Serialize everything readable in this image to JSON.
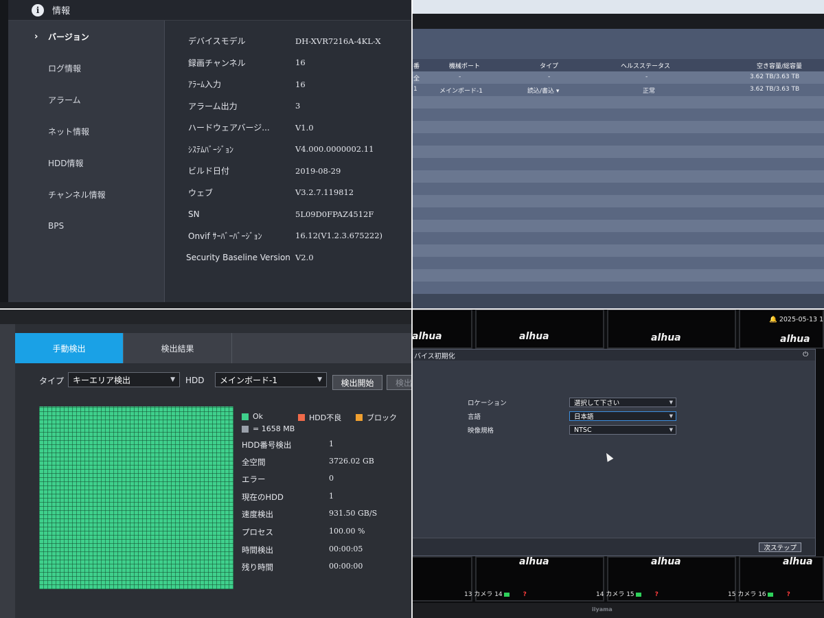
{
  "info_panel": {
    "title": "情報",
    "sidebar": [
      {
        "label": "バージョン",
        "active": true
      },
      {
        "label": "ログ情報"
      },
      {
        "label": "アラーム"
      },
      {
        "label": "ネット情報"
      },
      {
        "label": "HDD情報"
      },
      {
        "label": "チャンネル情報"
      },
      {
        "label": "BPS"
      }
    ],
    "rows": [
      {
        "key": "デバイスモデル",
        "value": "DH-XVR7216A-4KL-X"
      },
      {
        "key": "録画チャンネル",
        "value": "16"
      },
      {
        "key": "ｱﾗｰﾑ入力",
        "value": "16"
      },
      {
        "key": "アラーム出力",
        "value": "3"
      },
      {
        "key": "ハードウェアバージ...",
        "value": "V1.0"
      },
      {
        "key": "ｼｽﾃﾑﾊﾞｰｼﾞｮﾝ",
        "value": "V4.000.0000002.11"
      },
      {
        "key": "ビルド日付",
        "value": "2019-08-29"
      },
      {
        "key": "ウェブ",
        "value": "V3.2.7.119812"
      },
      {
        "key": "SN",
        "value": "5L09D0FPAZ4512F"
      },
      {
        "key": "Onvif ｻｰﾊﾞｰﾊﾞｰｼﾞｮﾝ",
        "value": "16.12(V1.2.3.675222)"
      },
      {
        "key": "Security Baseline Version",
        "value": "V2.0"
      }
    ]
  },
  "hdd_list": {
    "headers": [
      "番",
      "機械ポート",
      "タイプ",
      "ヘルスステータス",
      "空き容量/総容量"
    ],
    "rows": [
      {
        "no": "全",
        "port": "-",
        "type": "-",
        "health": "-",
        "capacity": "3.62 TB/3.63 TB"
      },
      {
        "no": "1",
        "port": "メインボード-1",
        "type": "読込/書込",
        "health": "正常",
        "capacity": "3.62 TB/3.63 TB"
      }
    ]
  },
  "hdd_check": {
    "tabs": [
      "手動検出",
      "検出結果"
    ],
    "type_label": "タイプ",
    "type_value": "キーエリア検出",
    "hdd_label": "HDD",
    "hdd_value": "メインボード-1",
    "start_button": "検出開始",
    "next_button": "検出",
    "legend": [
      {
        "label": "Ok",
        "color": "#3fd08c"
      },
      {
        "label": "HDD不良",
        "color": "#f06a4a"
      },
      {
        "label": "ブロック",
        "color": "#f0a030"
      }
    ],
    "block_size": "= 1658 MB",
    "block_color": "#9aa0aa",
    "stats": [
      {
        "key": "HDD番号検出",
        "value": "1"
      },
      {
        "key": "全空間",
        "value": "3726.02 GB"
      },
      {
        "key": "エラー",
        "value": "0"
      },
      {
        "key": "現在のHDD",
        "value": "1"
      },
      {
        "key": "速度検出",
        "value": "931.50 GB/S"
      },
      {
        "key": "プロセス",
        "value": "100.00 %"
      },
      {
        "key": "時間検出",
        "value": "00:00:05"
      },
      {
        "key": "残り時間",
        "value": "00:00:00"
      }
    ]
  },
  "device_init": {
    "title": "バイス初期化",
    "datetime": "2025-05-13 1",
    "logo": "alhua",
    "fields": [
      {
        "label": "ロケーション",
        "value": "選択して下さい"
      },
      {
        "label": "言語",
        "value": "日本語"
      },
      {
        "label": "映像規格",
        "value": "NTSC"
      }
    ],
    "next_button": "次ステップ",
    "cameras": [
      {
        "num": "13",
        "name": "カメラ 14"
      },
      {
        "num": "14",
        "name": "カメラ 15"
      },
      {
        "num": "15",
        "name": "カメラ 16"
      }
    ],
    "monitor_brand": "iiyama"
  }
}
